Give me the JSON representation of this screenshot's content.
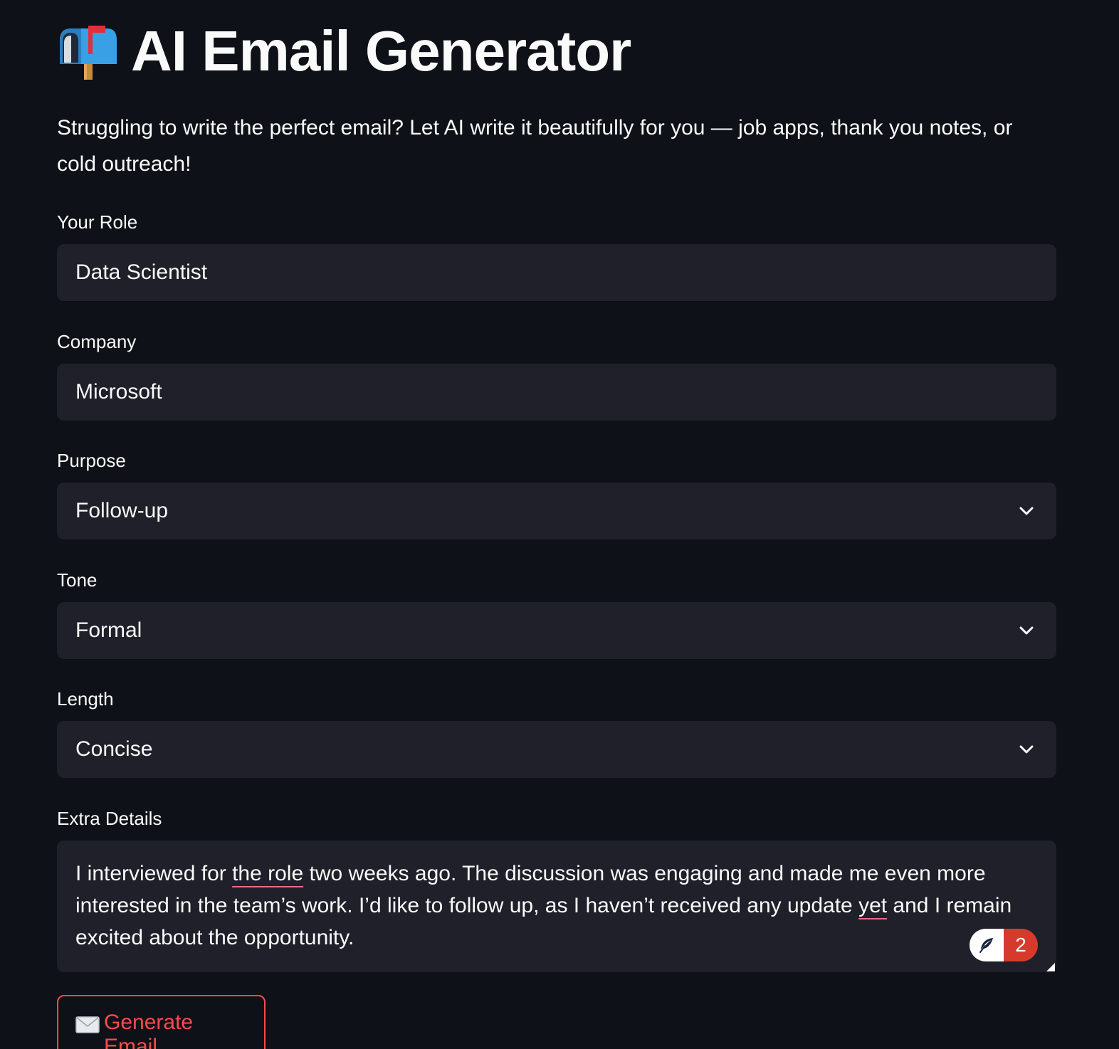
{
  "app": {
    "title": "AI Email Generator",
    "subtitle": "Struggling to write the perfect email? Let AI write it beautifully for you — job apps, thank you notes, or cold outreach!",
    "title_icon": "mailbox-icon"
  },
  "form": {
    "role": {
      "label": "Your Role",
      "value": "Data Scientist"
    },
    "company": {
      "label": "Company",
      "value": "Microsoft"
    },
    "purpose": {
      "label": "Purpose",
      "selected": "Follow-up"
    },
    "tone": {
      "label": "Tone",
      "selected": "Formal"
    },
    "length": {
      "label": "Length",
      "selected": "Concise"
    },
    "extra_details": {
      "label": "Extra Details",
      "segments": [
        "I interviewed for ",
        "the  role",
        " two weeks ago. The discussion was engaging and made me even more interested in the team’s work. I’d like to follow up, as I haven’t received any update ",
        "yet",
        " and I remain excited about the opportunity."
      ]
    },
    "grammar_badge": {
      "count": "2"
    },
    "submit": {
      "label": "Generate Email",
      "icon": "envelope-icon"
    }
  },
  "colors": {
    "background": "#0e1117",
    "input_background": "#1f2029",
    "accent": "#ff4b4b",
    "spell_underline": "#f06b83",
    "badge_red": "#d63a2c"
  }
}
